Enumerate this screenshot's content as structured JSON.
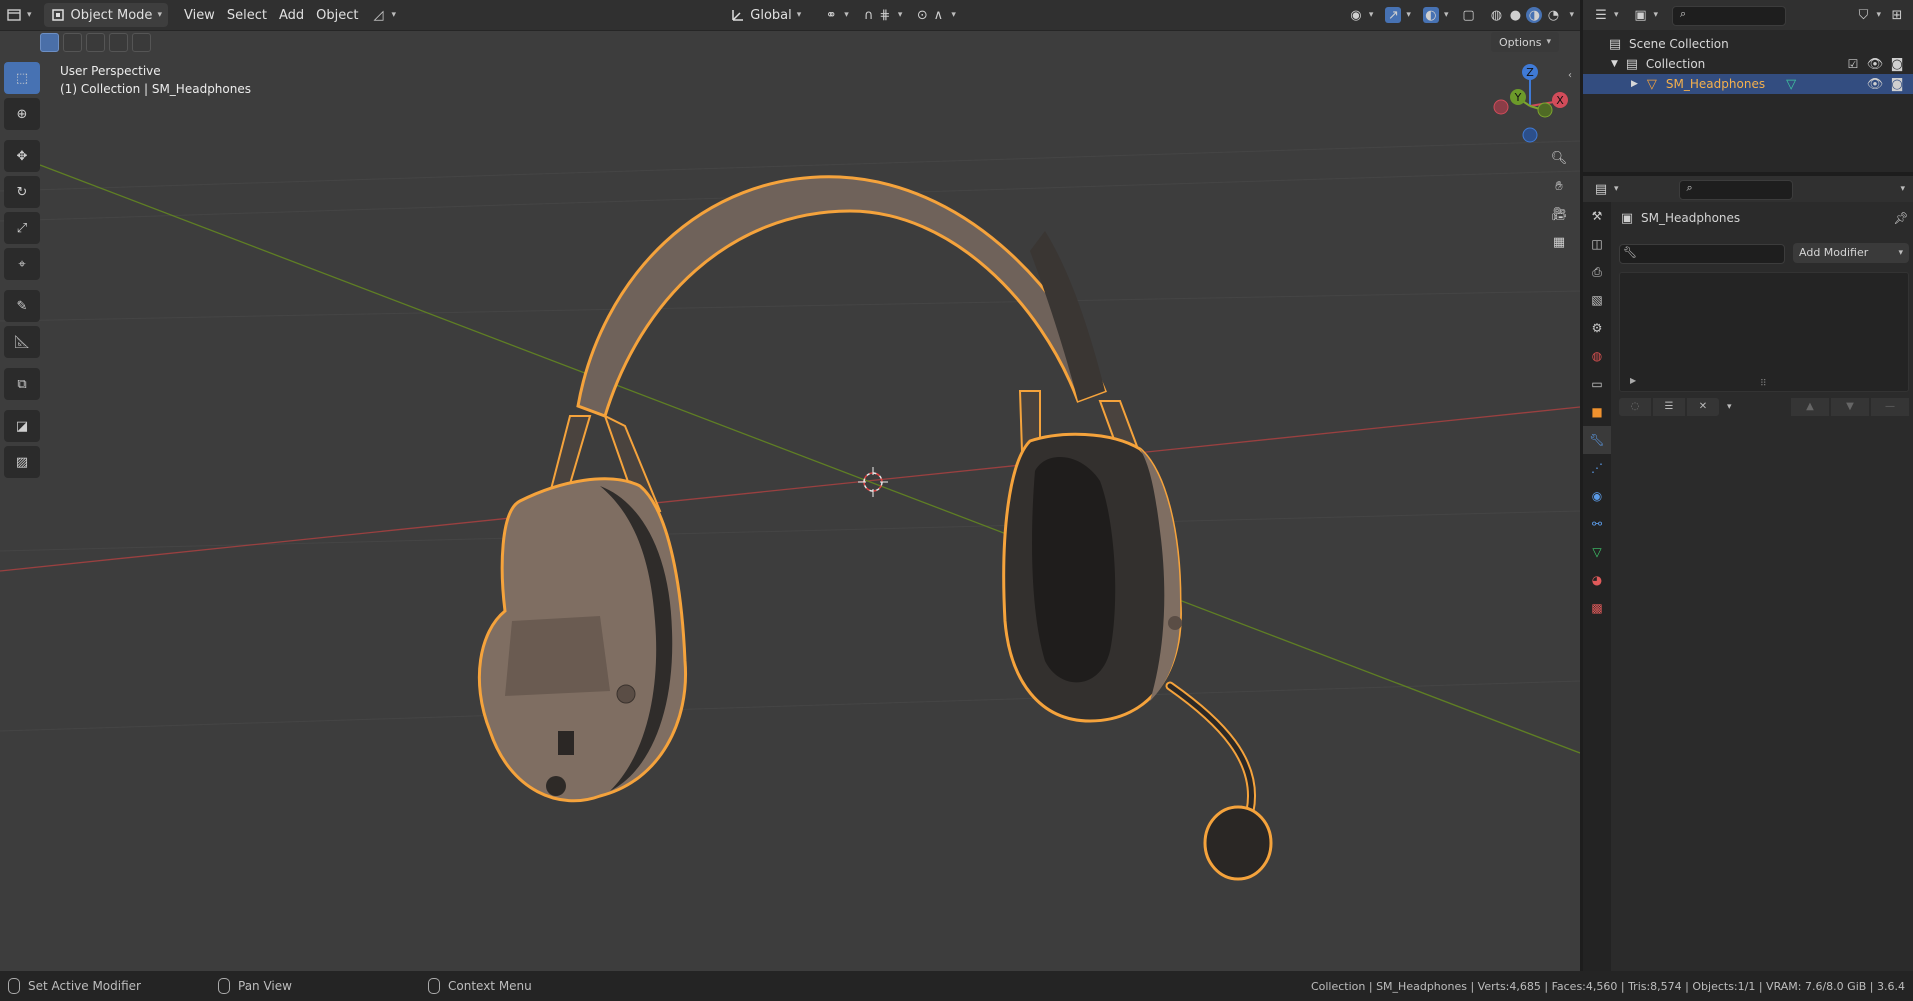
{
  "header": {
    "mode_label": "Object Mode",
    "menu": [
      "View",
      "Select",
      "Add",
      "Object"
    ],
    "orientation_label": "Global"
  },
  "viewport": {
    "perspective_label": "User Perspective",
    "collection_label": "(1) Collection | SM_Headphones",
    "options_label": "Options",
    "gizmo": {
      "z": "Z",
      "y": "Y",
      "x": "X"
    }
  },
  "outliner": {
    "scene_collection": "Scene Collection",
    "collection": "Collection",
    "object": "SM_Headphones"
  },
  "properties": {
    "object_name": "SM_Headphones",
    "add_modifier_label": "Add Modifier"
  },
  "status": {
    "left_action": "Set Active Modifier",
    "middle_action": "Pan View",
    "right_action": "Context Menu",
    "info": "Collection | SM_Headphones | Verts:4,685 | Faces:4,560 | Tris:8,574 | Objects:1/1 | VRAM: 7.6/8.0 GiB | 3.6.4"
  },
  "colors": {
    "accent": "#4772b3",
    "selection_outline": "#f5a33c",
    "axis_x": "#a14444",
    "axis_y": "#6c8a2c",
    "headphone_body": "#7d6a5e"
  },
  "icons": [
    "editor-type-icon",
    "object-mode-icon",
    "select-box-icon",
    "cursor-icon",
    "move-icon",
    "rotate-icon",
    "scale-icon",
    "transform-icon",
    "annotate-icon",
    "measure-icon",
    "add-cube-icon",
    "zoom-icon",
    "hand-icon",
    "camera-icon",
    "grid-icon",
    "eye-icon",
    "camera-render-icon",
    "wrench-icon",
    "filter-icon",
    "search-icon",
    "pin-icon"
  ]
}
